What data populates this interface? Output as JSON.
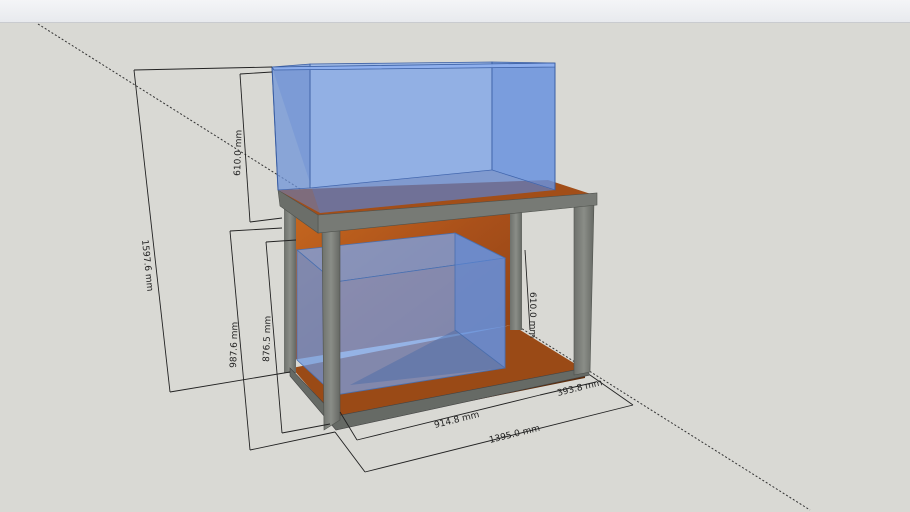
{
  "model": {
    "dimensions": {
      "total_height": "1597.6 mm",
      "tank_height": "610.0 mm",
      "stand_height": "987.6 mm",
      "inner_height": "876.5 mm",
      "shelf_height": "610.0 mm",
      "inner_width": "914.8 mm",
      "total_width": "1395.0 mm",
      "side_gap": "393.8 mm"
    },
    "colors": {
      "background": "#d9d9d4",
      "glass": "#6f9fe8",
      "wood": "#b45a1c",
      "steel": "#7b7e79",
      "dimension_line": "#222222"
    }
  }
}
